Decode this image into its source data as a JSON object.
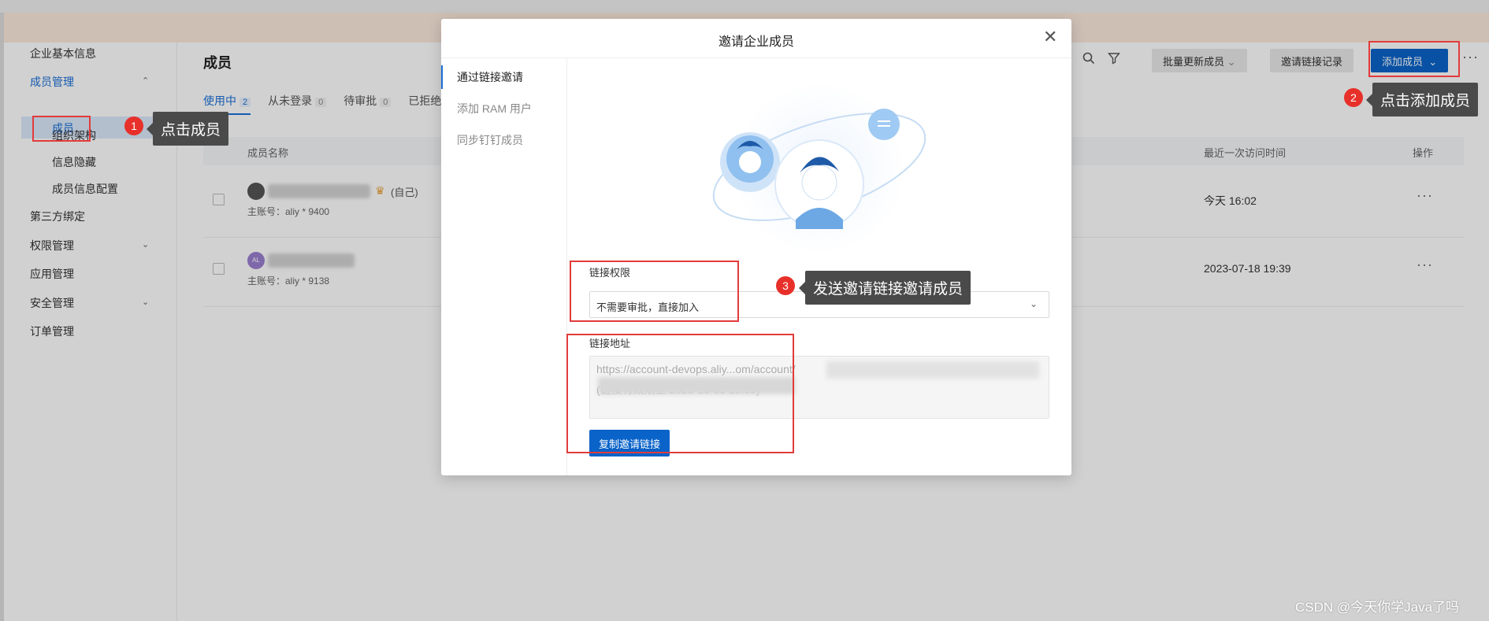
{
  "sidebar": {
    "items": [
      {
        "label": "企业基本信息"
      },
      {
        "label": "成员管理"
      },
      {
        "label": "成员"
      },
      {
        "label": "组织架构"
      },
      {
        "label": "信息隐藏"
      },
      {
        "label": "成员信息配置"
      },
      {
        "label": "第三方绑定"
      },
      {
        "label": "权限管理"
      },
      {
        "label": "应用管理"
      },
      {
        "label": "安全管理"
      },
      {
        "label": "订单管理"
      }
    ]
  },
  "main": {
    "title": "成员",
    "tabs": [
      {
        "label": "使用中",
        "count": "2"
      },
      {
        "label": "从未登录",
        "count": "0"
      },
      {
        "label": "待审批",
        "count": "0"
      },
      {
        "label": "已拒绝",
        "count": ""
      }
    ],
    "toolbar": {
      "batch_update": "批量更新成员",
      "invite_records": "邀请链接记录",
      "add_member": "添加成员"
    },
    "table": {
      "columns": {
        "name": "成员名称",
        "last_visit": "最近一次访问时间",
        "actions": "操作"
      },
      "rows": [
        {
          "self_tag": "(自己)",
          "account": "主账号：aliy * 9400",
          "last_visit": "今天 16:02"
        },
        {
          "avatar_text": "AL",
          "account": "主账号：aliy * 9138",
          "last_visit": "2023-07-18 19:39"
        }
      ]
    }
  },
  "modal": {
    "title": "邀请企业成员",
    "nav": [
      {
        "label": "通过链接邀请"
      },
      {
        "label": "添加 RAM 用户"
      },
      {
        "label": "同步钉钉成员"
      }
    ],
    "permission_label": "链接权限",
    "permission_value": "不需要审批，直接加入",
    "link_label": "链接地址",
    "link_line1": "https://account-devops.aliy...om/account/",
    "link_line2": "(链接有效期至 2023-10-05 15:59)",
    "copy_button": "复制邀请链接"
  },
  "annotations": {
    "step1": {
      "num": "1",
      "text": "点击成员"
    },
    "step2": {
      "num": "2",
      "text": "点击添加成员"
    },
    "step3": {
      "num": "3",
      "text": "发送邀请链接邀请成员"
    }
  },
  "watermark": "CSDN @今天你学Java了吗",
  "colors": {
    "primary": "#0a63c9",
    "annotation_red": "#e23b3b",
    "banner": "#fce9dc"
  },
  "icons": [
    "search-icon",
    "filter-icon",
    "chevron-down-icon",
    "more-icon",
    "close-icon",
    "crown-icon"
  ]
}
